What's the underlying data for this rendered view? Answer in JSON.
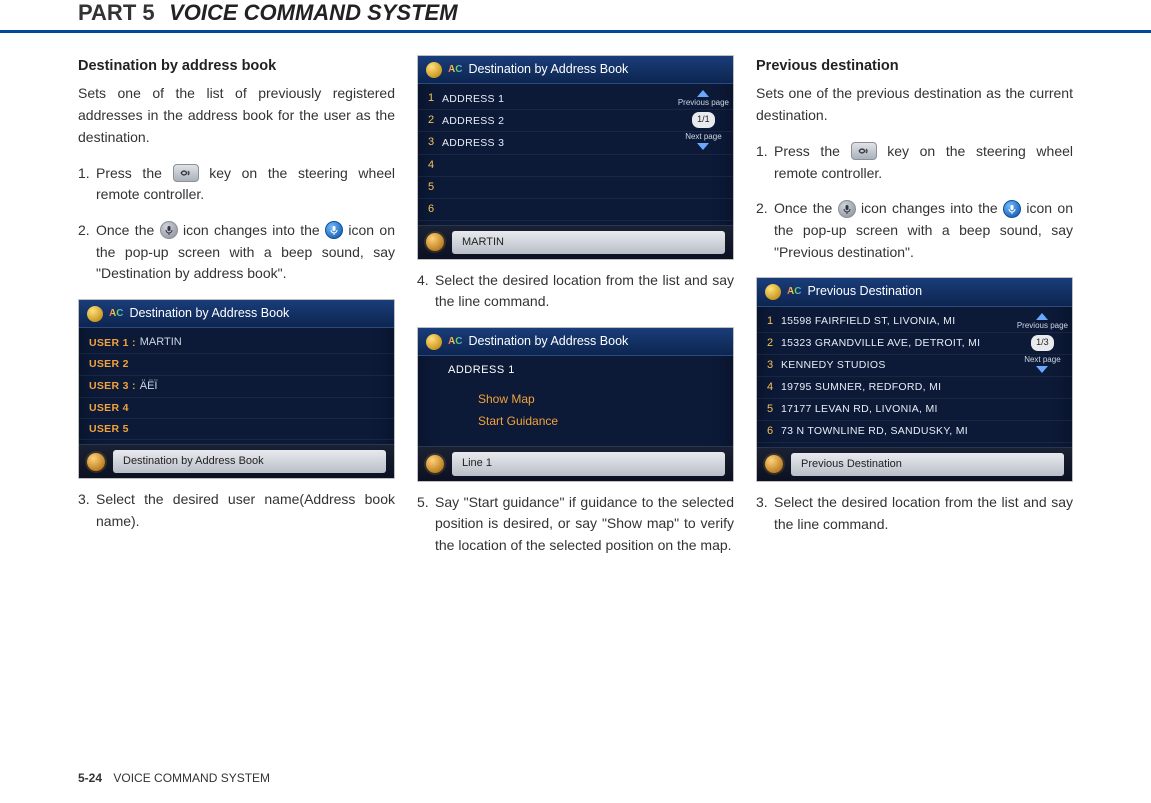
{
  "header": {
    "part": "PART 5",
    "title": "VOICE COMMAND SYSTEM"
  },
  "footer": {
    "page": "5-24",
    "label": "VOICE COMMAND SYSTEM"
  },
  "col1": {
    "heading": "Destination by address book",
    "intro": "Sets one of the list of previously registered addresses in the address book for the user as the destination.",
    "step1_pre": "Press the ",
    "step1_post": " key on the steering wheel remote controller.",
    "step2_pre": "Once the ",
    "step2_mid": " icon changes into the ",
    "step2_post": " icon on the pop-up screen with a beep sound, say \"Destination by address book\".",
    "step3": "Select the desired user name(Address book name).",
    "screen": {
      "title": "Destination by Address Book",
      "rows": [
        {
          "u": "USER 1 :",
          "v": "MARTIN"
        },
        {
          "u": "USER 2",
          "v": ""
        },
        {
          "u": "USER 3 :",
          "v": "ÄËÏ"
        },
        {
          "u": "USER 4",
          "v": ""
        },
        {
          "u": "USER 5",
          "v": ""
        }
      ],
      "footer": "Destination by Address Book"
    }
  },
  "col2": {
    "screenA": {
      "title": "Destination by Address Book",
      "rows": [
        "ADDRESS 1",
        "ADDRESS 2",
        "ADDRESS 3",
        "",
        "",
        ""
      ],
      "pager": {
        "prev": "Previous page",
        "count": "1/1",
        "next": "Next page"
      },
      "footer": "MARTIN"
    },
    "step4": "Select the desired location from the list and say the line command.",
    "screenB": {
      "title": "Destination by Address Book",
      "addr": "ADDRESS 1",
      "opt1": "Show Map",
      "opt2": "Start Guidance",
      "footer": "Line 1"
    },
    "step5": "Say \"Start guidance\" if guidance to the selected position is desired, or say \"Show map\" to verify the location of the selected position on the map."
  },
  "col3": {
    "heading": "Previous destination",
    "intro": "Sets one of the previous destination as the current destination.",
    "step1_pre": "Press the ",
    "step1_post": " key on the steering wheel remote controller.",
    "step2_pre": "Once the ",
    "step2_mid": " icon changes into the ",
    "step2_post": " icon on the pop-up screen with a beep sound, say \"Previous destination\".",
    "step3": "Select the desired location from the list and say the line command.",
    "screen": {
      "title": "Previous Destination",
      "rows": [
        "15598 FAIRFIELD ST, LIVONIA, MI",
        "15323 GRANDVILLE AVE, DETROIT, MI",
        "KENNEDY STUDIOS",
        "19795 SUMNER, REDFORD, MI",
        "17177 LEVAN RD, LIVONIA, MI",
        "73 N TOWNLINE RD, SANDUSKY, MI"
      ],
      "pager": {
        "prev": "Previous page",
        "count": "1/3",
        "next": "Next page"
      },
      "footer": "Previous Destination"
    }
  }
}
